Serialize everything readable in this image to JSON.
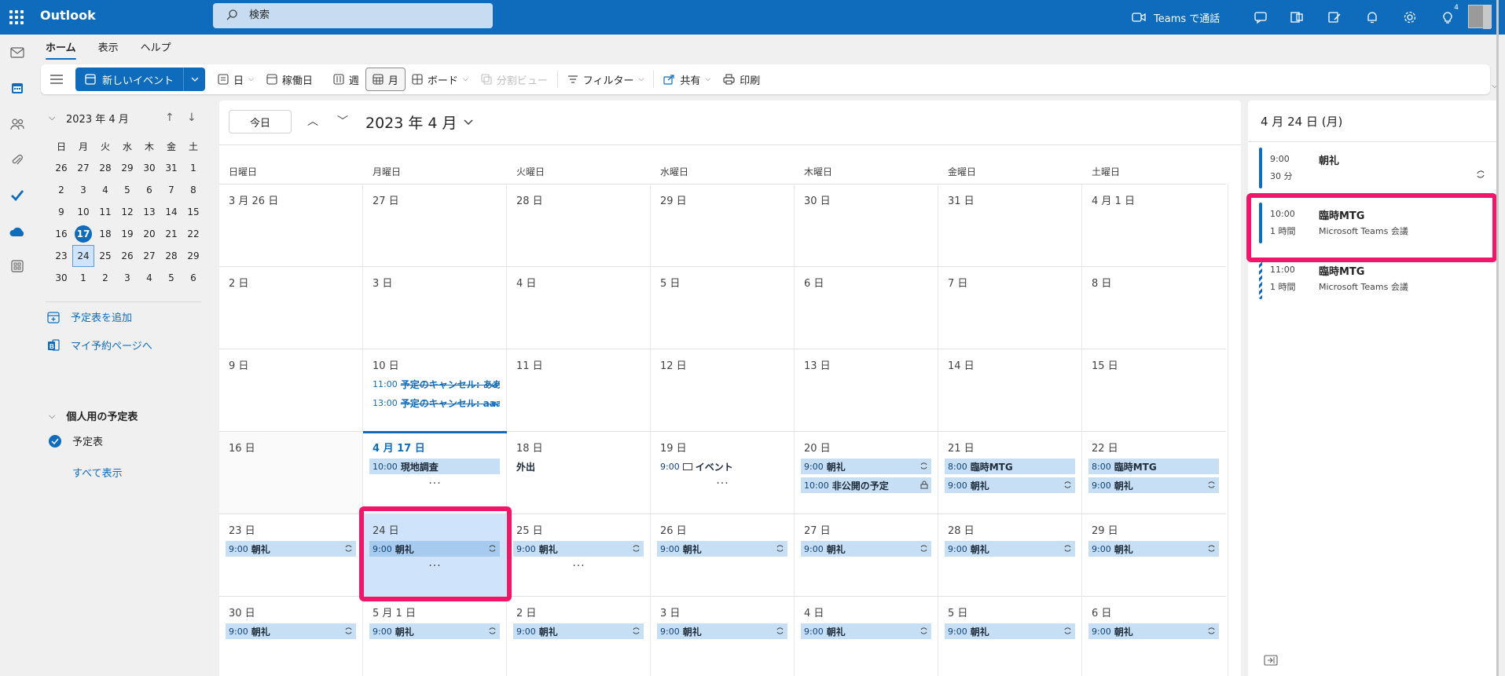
{
  "app": {
    "name": "Outlook"
  },
  "search": {
    "placeholder": "検索"
  },
  "topbar": {
    "teams_label": "Teams で通話",
    "tips_badge": "4"
  },
  "menu": {
    "tabs": [
      "ホーム",
      "表示",
      "ヘルプ"
    ]
  },
  "ribbon": {
    "new_event": "新しいイベント",
    "day": "日",
    "workweek": "稼働日",
    "week": "週",
    "month": "月",
    "board": "ボード",
    "split": "分割ビュー",
    "filter": "フィルター",
    "share": "共有",
    "print": "印刷"
  },
  "mini_calendar": {
    "title": "2023 年 4 月",
    "weekdays": [
      "日",
      "月",
      "火",
      "水",
      "木",
      "金",
      "土"
    ],
    "weeks": [
      [
        "26",
        "27",
        "28",
        "29",
        "30",
        "31",
        "1"
      ],
      [
        "2",
        "3",
        "4",
        "5",
        "6",
        "7",
        "8"
      ],
      [
        "9",
        "10",
        "11",
        "12",
        "13",
        "14",
        "15"
      ],
      [
        "16",
        "17",
        "18",
        "19",
        "20",
        "21",
        "22"
      ],
      [
        "23",
        "24",
        "25",
        "26",
        "27",
        "28",
        "29"
      ],
      [
        "30",
        "1",
        "2",
        "3",
        "4",
        "5",
        "6"
      ]
    ]
  },
  "left_links": {
    "add_calendar": "予定表を追加",
    "booking": "マイ予約ページへ",
    "group": "個人用の予定表",
    "calendar": "予定表",
    "show_all": "すべて表示"
  },
  "calendar": {
    "today_button": "今日",
    "month_title": "2023 年 4 月",
    "weekdays": [
      "日曜日",
      "月曜日",
      "火曜日",
      "水曜日",
      "木曜日",
      "金曜日",
      "土曜日"
    ],
    "weeks": [
      [
        "3 月 26 日",
        "27 日",
        "28 日",
        "29 日",
        "30 日",
        "31 日",
        "4 月 1 日"
      ],
      [
        "2 日",
        "3 日",
        "4 日",
        "5 日",
        "6 日",
        "7 日",
        "8 日"
      ],
      [
        "9 日",
        "10 日",
        "11 日",
        "12 日",
        "13 日",
        "14 日",
        "15 日"
      ],
      [
        "16 日",
        "4 月 17 日",
        "18 日",
        "19 日",
        "20 日",
        "21 日",
        "22 日"
      ],
      [
        "23 日",
        "24 日",
        "25 日",
        "26 日",
        "27 日",
        "28 日",
        "29 日"
      ],
      [
        "30 日",
        "5 月 1 日",
        "2 日",
        "3 日",
        "4 日",
        "5 日",
        "6 日"
      ]
    ],
    "events": {
      "cancel1": {
        "time": "11:00",
        "title": "予定のキャンセル: ああ"
      },
      "cancel2": {
        "time": "13:00",
        "title": "予定のキャンセル: aaa"
      },
      "genchi": {
        "time": "10:00",
        "title": "現地調査"
      },
      "gaishutsu": {
        "title": "外出"
      },
      "event19": {
        "time": "9:00",
        "title": "イベント"
      },
      "chorei": {
        "time": "9:00",
        "title": "朝礼"
      },
      "hikoukai": {
        "time": "10:00",
        "title": "非公開の予定"
      },
      "rinji": {
        "time": "8:00",
        "title": "臨時MTG"
      },
      "more": "···"
    }
  },
  "agenda": {
    "title": "4 月 24 日 (月)",
    "items": [
      {
        "time": "9:00",
        "duration": "30 分",
        "title": "朝礼",
        "sub": ""
      },
      {
        "time": "10:00",
        "duration": "1 時間",
        "title": "臨時MTG",
        "sub": "Microsoft Teams 会議"
      },
      {
        "time": "11:00",
        "duration": "1 時間",
        "title": "臨時MTG",
        "sub": "Microsoft Teams 会議"
      }
    ]
  },
  "colors": {
    "accent": "#0f6cbd",
    "highlight": "#f0176b",
    "event_bg": "#c7dff5"
  }
}
